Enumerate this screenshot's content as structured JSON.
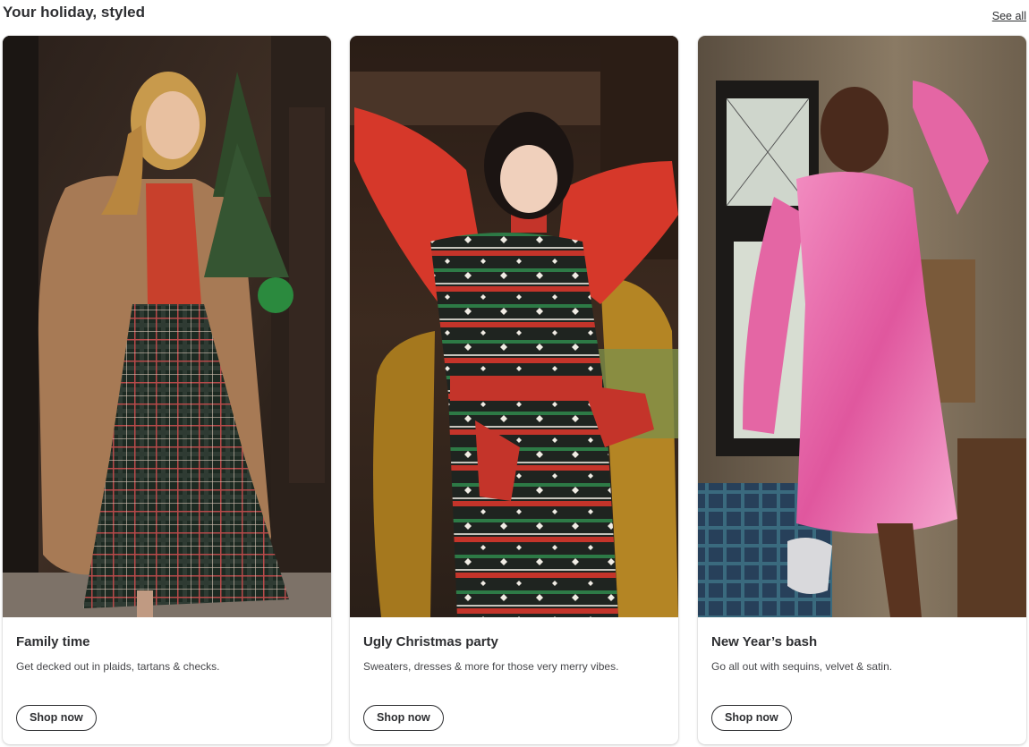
{
  "section": {
    "title": "Your holiday, styled",
    "see_all": "See all"
  },
  "cards": [
    {
      "title": "Family time",
      "description": "Get decked out in plaids, tartans & checks.",
      "button": "Shop now",
      "image": "woman-in-tan-coat-plaid-skirt-holding-small-tree"
    },
    {
      "title": "Ugly Christmas party",
      "description": "Sweaters, dresses & more for those very merry vibes.",
      "button": "Shop now",
      "image": "woman-in-santas-favorite-sweater-dress-on-gold-chair"
    },
    {
      "title": "New Year’s bash",
      "description": "Go all out with sequins, velvet & satin.",
      "button": "Shop now",
      "image": "woman-in-pink-sequin-dress-with-silver-purse"
    }
  ],
  "colors": {
    "text": "#2e2f32",
    "card_background": "#ffffff"
  }
}
